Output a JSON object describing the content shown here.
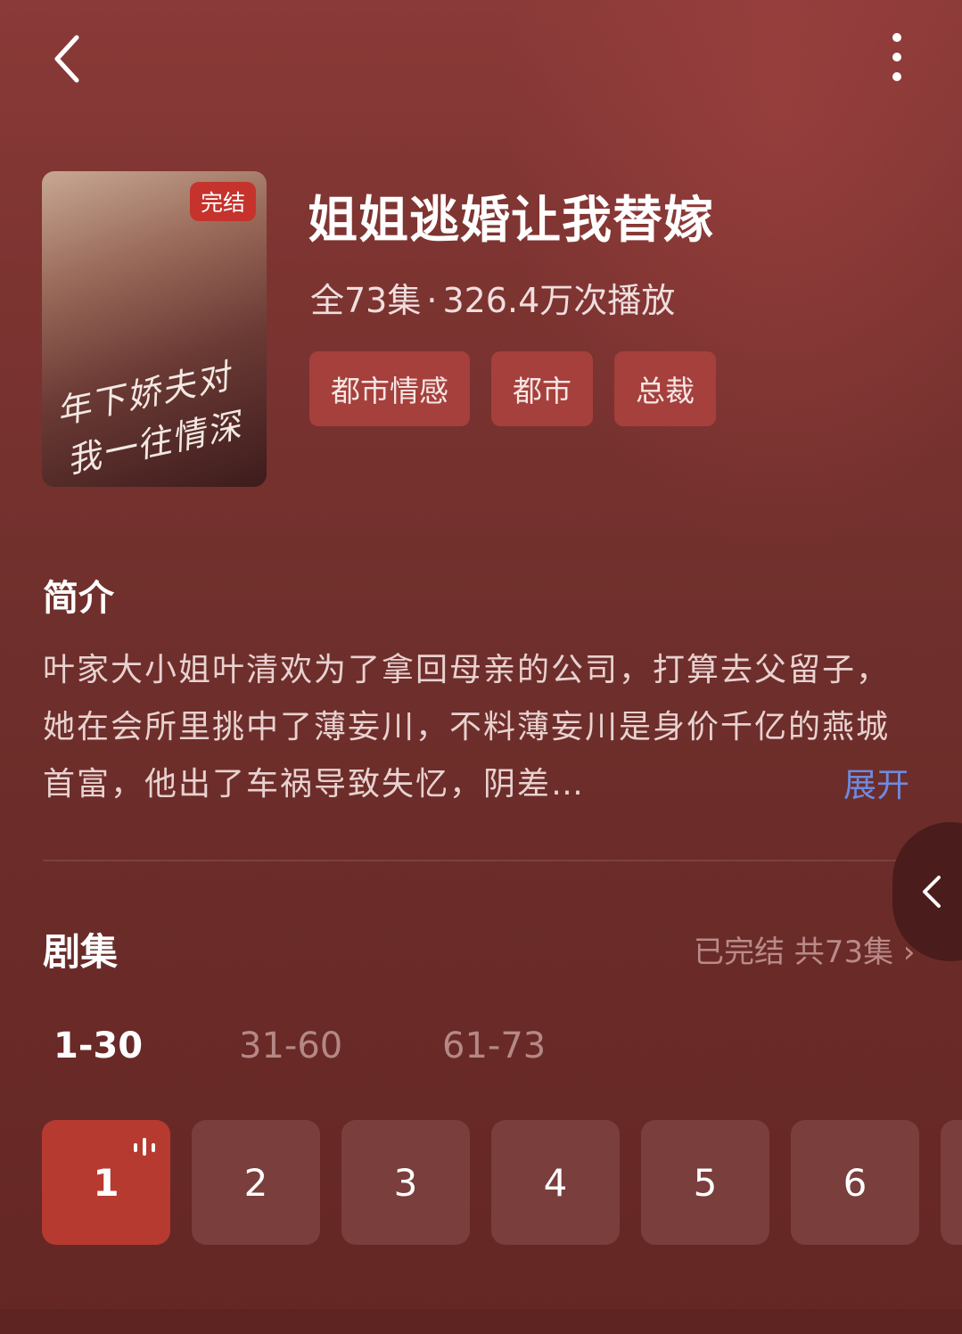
{
  "header": {
    "back_icon": "back-chevron-icon",
    "more_icon": "more-vertical-icon"
  },
  "show": {
    "badge": "完结",
    "poster_text": "年下娇夫对我一往情深",
    "title": "姐姐逃婚让我替嫁",
    "total_episodes": "全73集",
    "separator": "·",
    "plays": "326.4万次播放",
    "tags": [
      "都市情感",
      "都市",
      "总裁"
    ]
  },
  "intro": {
    "heading": "简介",
    "text": "叶家大小姐叶清欢为了拿回母亲的公司，打算去父留子，她在会所里挑中了薄妄川，不料薄妄川是身价千亿的燕城首富，他出了车祸导致失忆，阴差…",
    "expand_label": "展开"
  },
  "episodes": {
    "heading": "剧集",
    "status": "已完结 共73集 ›",
    "ranges": [
      "1-30",
      "31-60",
      "61-73"
    ],
    "active_range": 0,
    "items": [
      "1",
      "2",
      "3",
      "4",
      "5",
      "6"
    ],
    "current": 0
  },
  "colors": {
    "accent": "#b63a30",
    "tag_bg": "#a5403c",
    "link": "#6e8ae0"
  }
}
